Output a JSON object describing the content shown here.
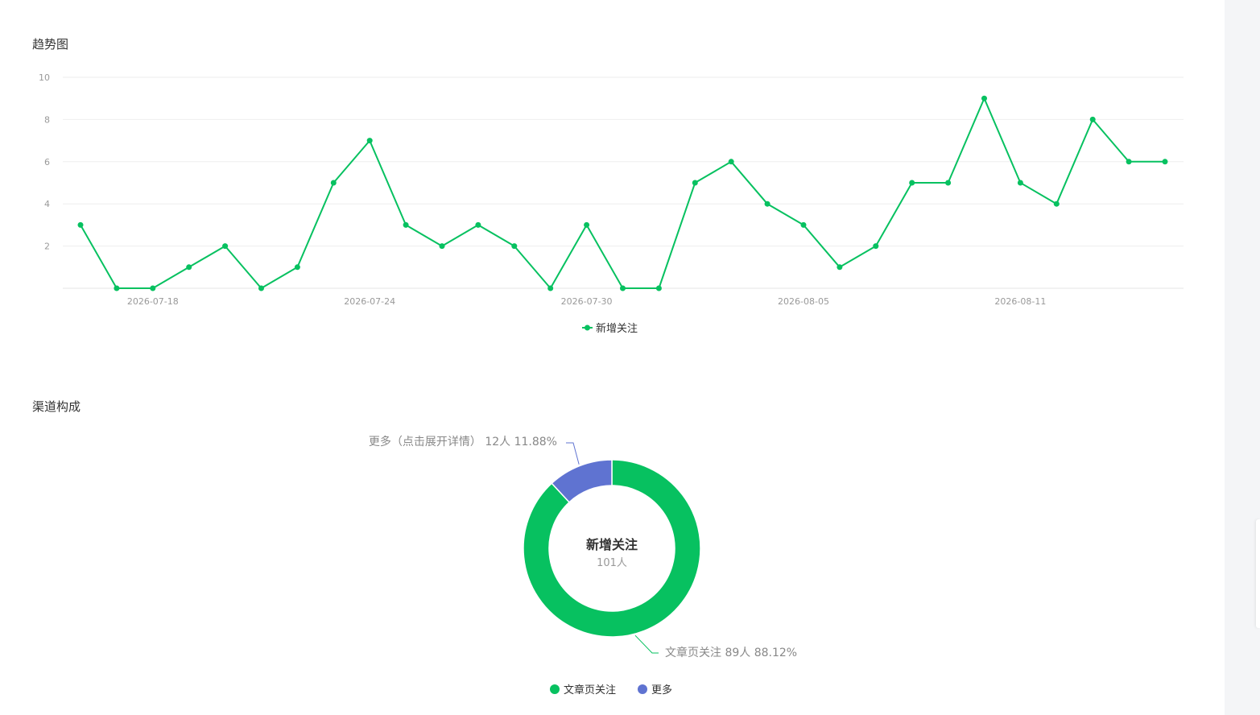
{
  "sections": {
    "trend_title": "趋势图",
    "pie_title": "渠道构成"
  },
  "colors": {
    "line": "#07c160",
    "pie_main": "#07c160",
    "pie_more": "#5f73d1",
    "grid": "#eeeeee",
    "axis_text": "#999999"
  },
  "chart_data": [
    {
      "type": "line",
      "title": "趋势图",
      "x": [
        "2026-07-16",
        "2026-07-17",
        "2026-07-18",
        "2026-07-19",
        "2026-07-20",
        "2026-07-21",
        "2026-07-22",
        "2026-07-23",
        "2026-07-24",
        "2026-07-25",
        "2026-07-26",
        "2026-07-27",
        "2026-07-28",
        "2026-07-29",
        "2026-07-30",
        "2026-07-31",
        "2026-08-01",
        "2026-08-02",
        "2026-08-03",
        "2026-08-04",
        "2026-08-05",
        "2026-08-06",
        "2026-08-07",
        "2026-08-08",
        "2026-08-09",
        "2026-08-10",
        "2026-08-11",
        "2026-08-12",
        "2026-08-13"
      ],
      "x_tick_labels": [
        "2026-07-18",
        "2026-07-24",
        "2026-07-30",
        "2026-08-05",
        "2026-08-11"
      ],
      "series": [
        {
          "name": "新增关注",
          "values": [
            3,
            0,
            0,
            1,
            2,
            0,
            1,
            5,
            7,
            3,
            2,
            3,
            2,
            0,
            3,
            0,
            0,
            5,
            6,
            4,
            3,
            1,
            2,
            5,
            5,
            9,
            5,
            4,
            8,
            6,
            6
          ]
        }
      ],
      "y_ticks": [
        "2",
        "4",
        "6",
        "8",
        "10"
      ],
      "ylim": [
        0,
        10
      ],
      "grid": true,
      "legend_position": "bottom-center"
    },
    {
      "type": "pie",
      "title": "渠道构成",
      "center_title": "新增关注",
      "center_value": "101人",
      "slices": [
        {
          "name": "文章页关注",
          "value": 89,
          "percent": 88.12,
          "label": "文章页关注 89人 88.12%"
        },
        {
          "name": "更多",
          "value": 12,
          "percent": 11.88,
          "label": "更多（点击展开详情） 12人 11.88%"
        }
      ],
      "legend": [
        "文章页关注",
        "更多"
      ],
      "legend_position": "bottom-center"
    }
  ]
}
